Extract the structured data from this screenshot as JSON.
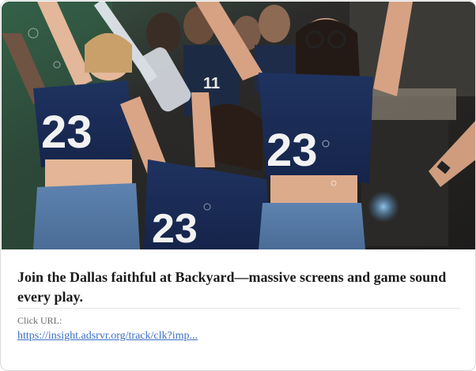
{
  "ad": {
    "image_alt": "Dallas Cowboys fans in #23 jerseys celebrating at Backyard",
    "jersey_number": "23",
    "headline": "Join the Dallas faithful at Backyard—massive screens and game sound every play.",
    "click_label": "Click URL:",
    "click_url_text": "https://insight.adsrvr.org/track/clk?imp...",
    "link_color": "#3b6fc4"
  }
}
